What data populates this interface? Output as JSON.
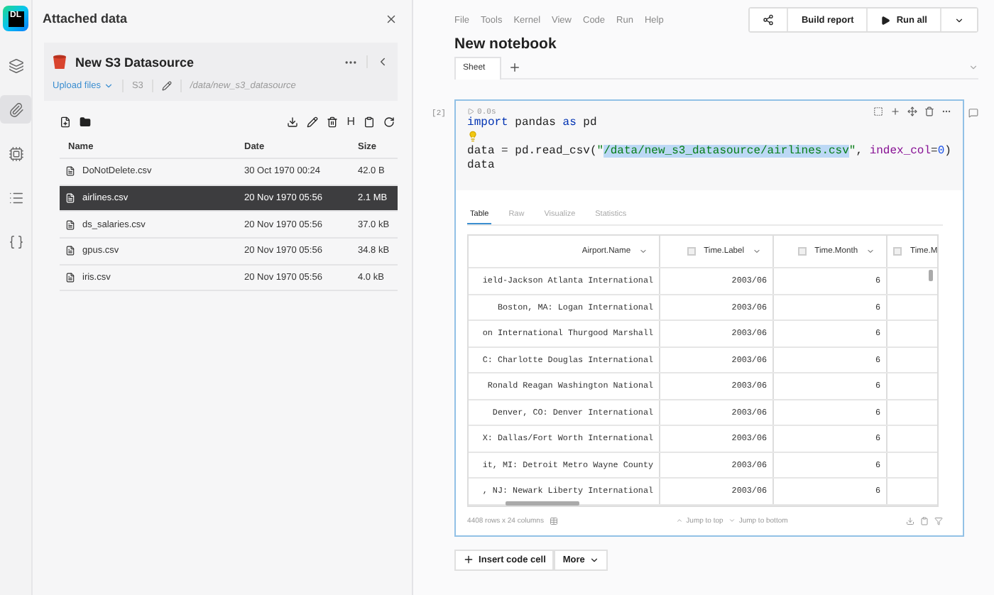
{
  "rail": {
    "logo": "DL",
    "items": [
      {
        "kind": "layers",
        "selected": false
      },
      {
        "kind": "attach",
        "selected": true
      },
      {
        "kind": "chip",
        "selected": false
      },
      {
        "kind": "list",
        "selected": false
      },
      {
        "kind": "braces",
        "selected": false
      }
    ]
  },
  "panel": {
    "title": "Attached data",
    "datasource": {
      "name": "New S3 Datasource",
      "upload": "Upload files",
      "type": "S3",
      "path": "/data/new_s3_datasource"
    },
    "toolbar_letter": "H",
    "columns": [
      "Name",
      "Date",
      "Size"
    ],
    "files": [
      {
        "name": "DoNotDelete.csv",
        "date": "30 Oct 1970 00:24",
        "size": "42.0 B",
        "selected": false
      },
      {
        "name": "airlines.csv",
        "date": "20 Nov 1970 05:56",
        "size": "2.1 MB",
        "selected": true
      },
      {
        "name": "ds_salaries.csv",
        "date": "20 Nov 1970 05:56",
        "size": "37.0 kB",
        "selected": false
      },
      {
        "name": "gpus.csv",
        "date": "20 Nov 1970 05:56",
        "size": "34.8 kB",
        "selected": false
      },
      {
        "name": "iris.csv",
        "date": "20 Nov 1970 05:56",
        "size": "4.0 kB",
        "selected": false
      }
    ]
  },
  "menu": [
    "File",
    "Tools",
    "Kernel",
    "View",
    "Code",
    "Run",
    "Help"
  ],
  "actions": {
    "build": "Build report",
    "run": "Run all"
  },
  "notebook": {
    "title": "New notebook",
    "tabs": [
      {
        "label": "Sheet",
        "selected": true
      }
    ]
  },
  "cell": {
    "number": "[2]",
    "timing": "0.0s",
    "lines": [
      [
        {
          "kind": "keyword",
          "text": "import"
        },
        {
          "kind": "text",
          "text": " pandas "
        },
        {
          "kind": "keyword",
          "text": "as"
        },
        {
          "kind": "text",
          "text": " pd"
        }
      ],
      [
        {
          "kind": "bulb"
        }
      ],
      [
        {
          "kind": "text",
          "text": "data = pd.read_csv("
        },
        {
          "kind": "string",
          "text": "\""
        },
        {
          "kind": "selection",
          "text": "/data/new_s3_datasource/airlines.csv"
        },
        {
          "kind": "string",
          "text": "\""
        },
        {
          "kind": "text",
          "text": ", "
        },
        {
          "kind": "param",
          "text": "index_col"
        },
        {
          "kind": "text",
          "text": "="
        },
        {
          "kind": "number",
          "text": "0"
        },
        {
          "kind": "text",
          "text": ")"
        }
      ],
      [
        {
          "kind": "text",
          "text": "data"
        }
      ]
    ],
    "output_tabs": [
      {
        "label": "Table",
        "selected": true
      },
      {
        "label": "Raw",
        "selected": false
      },
      {
        "label": "Visualize",
        "selected": false
      },
      {
        "label": "Statistics",
        "selected": false
      }
    ],
    "table": {
      "columns": [
        {
          "name": "Airport.Name",
          "kind": "plain"
        },
        {
          "name": "Time.Label",
          "kind": "text"
        },
        {
          "name": "Time.Month",
          "kind": "number"
        },
        {
          "name": "Time.M",
          "kind": "text"
        }
      ],
      "rows": [
        [
          "ield-Jackson Atlanta International",
          "2003/06",
          "6"
        ],
        [
          "Boston, MA: Logan International",
          "2003/06",
          "6"
        ],
        [
          "on International Thurgood Marshall",
          "2003/06",
          "6"
        ],
        [
          "C: Charlotte Douglas International",
          "2003/06",
          "6"
        ],
        [
          "Ronald Reagan Washington National",
          "2003/06",
          "6"
        ],
        [
          "Denver, CO: Denver International",
          "2003/06",
          "6"
        ],
        [
          "X: Dallas/Fort Worth International",
          "2003/06",
          "6"
        ],
        [
          "it, MI: Detroit Metro Wayne County",
          "2003/06",
          "6"
        ],
        [
          ", NJ: Newark Liberty International",
          "2003/06",
          "6"
        ]
      ]
    },
    "footer": {
      "count": "4408 rows x 24 columns",
      "top": "Jump to top",
      "bottom": "Jump to bottom"
    }
  },
  "bottom": {
    "insert": "Insert code cell",
    "more": "More"
  }
}
